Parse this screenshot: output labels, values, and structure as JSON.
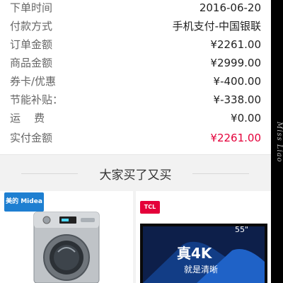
{
  "order": {
    "rows": [
      {
        "label": "下单时间",
        "value": "2016-06-20"
      },
      {
        "label": "付款方式",
        "value": "手机支付-中国银联"
      },
      {
        "label": "订单金额",
        "value": "¥2261.00"
      },
      {
        "label": "商品金额",
        "value": "¥2999.00"
      },
      {
        "label": "券卡/优惠",
        "value": "¥-400.00"
      },
      {
        "label": "节能补贴：",
        "value": "¥-338.00"
      },
      {
        "label": "运    费",
        "value": "¥0.00"
      },
      {
        "label": "实付金额",
        "value": "¥2261.00"
      }
    ]
  },
  "recommend": {
    "title": "大家买了又买"
  },
  "products": [
    {
      "brand": "美的 Midea"
    },
    {
      "brand": "TCL",
      "size": "55\"",
      "headline": "真4K",
      "tagline": "就是清晰"
    }
  ],
  "watermark": "Miss Liao",
  "colors": {
    "accent_red": "#e4003a",
    "label_gray": "#666666",
    "band_gray": "#f2f2f2",
    "midea_blue": "#1e7fd1"
  }
}
